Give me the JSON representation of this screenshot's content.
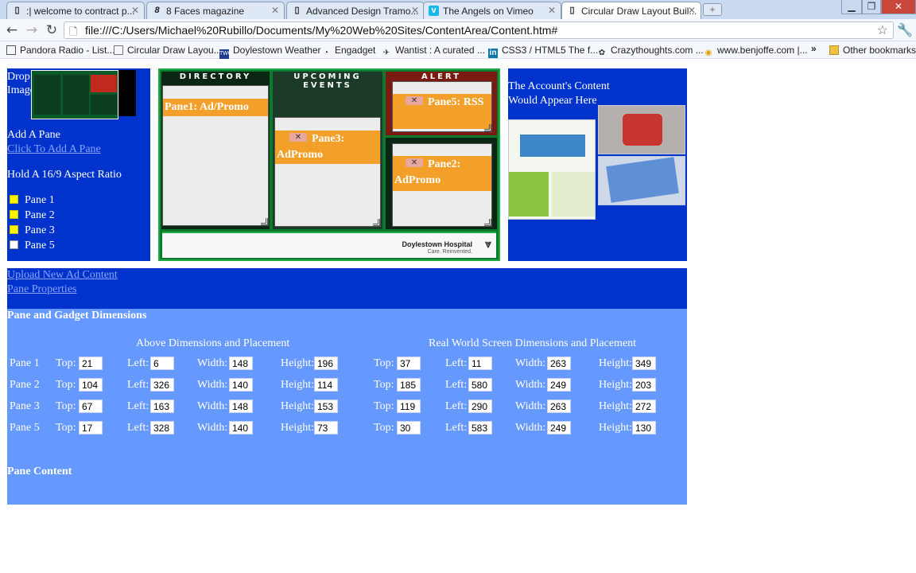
{
  "browser": {
    "tabs": [
      {
        "label": ":| welcome to contract p...",
        "icon": "page-icon"
      },
      {
        "label": "8 Faces magazine",
        "icon": "eight-faces-icon"
      },
      {
        "label": "Advanced Design Tramo...",
        "icon": "page-icon"
      },
      {
        "label": "The Angels on Vimeo",
        "icon": "vimeo-icon"
      },
      {
        "label": "Circular Draw Layout Buil...",
        "icon": "page-icon"
      }
    ],
    "new_tab": "+",
    "address": "file:///C:/Users/Michael%20Rubillo/Documents/My%20Web%20Sites/ContentArea/Content.htm#",
    "bookmarks": [
      {
        "label": "Pandora Radio - List...",
        "icon": "pandora-icon"
      },
      {
        "label": "Circular Draw Layou...",
        "icon": "page-icon"
      },
      {
        "label": "Doylestown Weather",
        "icon": "twc-icon"
      },
      {
        "label": "Engadget",
        "icon": "rss-icon"
      },
      {
        "label": "Wantist : A curated ...",
        "icon": "wantist-icon"
      },
      {
        "label": "CSS3 / HTML5 The f...",
        "icon": "linkedin-icon"
      },
      {
        "label": "Crazythoughts.com ...",
        "icon": "crazythoughts-icon"
      },
      {
        "label": "www.benjoffe.com |...",
        "icon": "globe-icon"
      }
    ],
    "bookmarks_more": "»",
    "other_bookmarks": "Other bookmarks"
  },
  "left_panel": {
    "drop_image": [
      "Drop",
      "Image"
    ],
    "add_pane": "Add A Pane",
    "click_to_add": "Click To Add A Pane",
    "aspect_ratio": "Hold A 16/9 Aspect Ratio",
    "panes": [
      {
        "label": "Pane 1",
        "checked": true
      },
      {
        "label": "Pane 2",
        "checked": true
      },
      {
        "label": "Pane 3",
        "checked": true
      },
      {
        "label": "Pane 5",
        "checked": false
      }
    ]
  },
  "layout": {
    "columns": [
      "DIRECTORY",
      "UPCOMING EVENTS",
      "ALERT"
    ],
    "pane1": "Pane1: Ad/Promo",
    "pane3": "Pane3: AdPromo",
    "pane5": "Pane5: RSS",
    "pane2": "Pane2: AdPromo",
    "close_glyph": "✕",
    "hospital_name": "Doylestown Hospital",
    "hospital_tagline": "Care. Reinvented."
  },
  "right_panel": {
    "account_content": "The Account's Content Would Appear Here"
  },
  "upload": {
    "upload_ad": "Upload New Ad Content",
    "pane_properties": "Pane Properties"
  },
  "dimensions": {
    "title": "Pane and Gadget Dimensions",
    "above_heading": "Above Dimensions and Placement",
    "real_heading": "Real World Screen Dimensions and Placement",
    "labels": {
      "top": "Top:",
      "left": "Left:",
      "width": "Width:",
      "height": "Height:"
    },
    "rows": [
      {
        "pane": "Pane 1",
        "above": {
          "top": "21",
          "left": "6",
          "width": "148",
          "height": "196"
        },
        "real": {
          "top": "37",
          "left": "11",
          "width": "263",
          "height": "349"
        }
      },
      {
        "pane": "Pane 2",
        "above": {
          "top": "104",
          "left": "326",
          "width": "140",
          "height": "114"
        },
        "real": {
          "top": "185",
          "left": "580",
          "width": "249",
          "height": "203"
        }
      },
      {
        "pane": "Pane 3",
        "above": {
          "top": "67",
          "left": "163",
          "width": "148",
          "height": "153"
        },
        "real": {
          "top": "119",
          "left": "290",
          "width": "263",
          "height": "272"
        }
      },
      {
        "pane": "Pane 5",
        "above": {
          "top": "17",
          "left": "328",
          "width": "140",
          "height": "73"
        },
        "real": {
          "top": "30",
          "left": "583",
          "width": "249",
          "height": "130"
        }
      }
    ],
    "content_title": "Pane Content"
  }
}
